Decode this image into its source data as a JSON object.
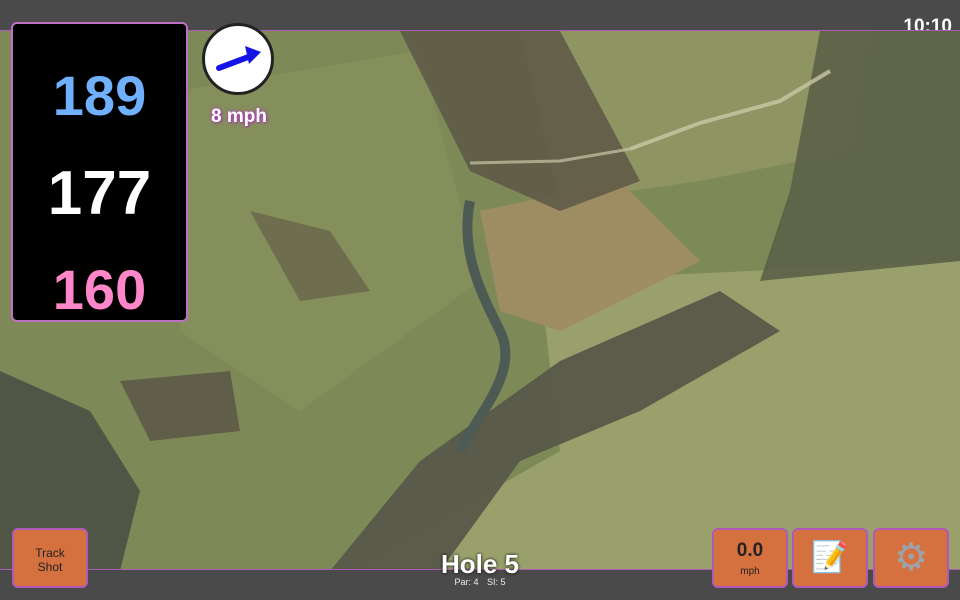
{
  "status_bar": {
    "time": "10:10"
  },
  "yardages": {
    "back": "189",
    "middle": "177",
    "front": "160"
  },
  "wind": {
    "speed": "8 mph",
    "direction_icon": "arrow-right-up-icon"
  },
  "hole": {
    "title": "Hole 5",
    "par": "Par: 4",
    "stroke_index": "SI: 5"
  },
  "buttons": {
    "track_shot": "Track\nShot",
    "speed_value": "0.0",
    "speed_unit": "mph",
    "notes_icon": "notepad-icon",
    "settings_icon": "gear-icon"
  },
  "colors": {
    "back_yardage": "#6fb0ff",
    "front_yardage": "#ff86c8",
    "button_bg": "#d5713f",
    "accent_border": "#b05ab8"
  }
}
